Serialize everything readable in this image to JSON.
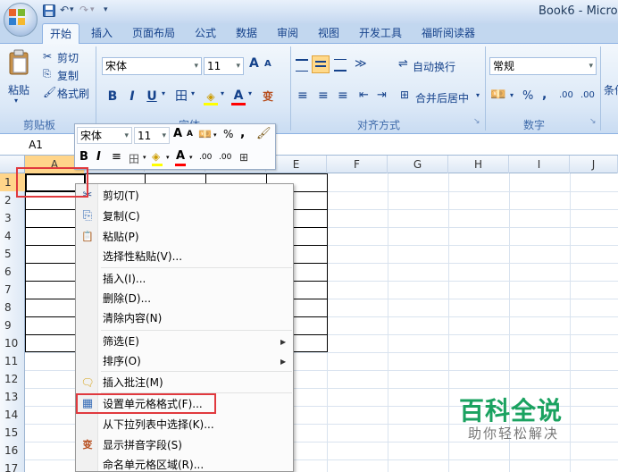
{
  "window": {
    "title": "Book6 - Micro",
    "qat_undo": "↶",
    "qat_redo": "↷",
    "qat_more": "▾"
  },
  "tabs": [
    "开始",
    "插入",
    "页面布局",
    "公式",
    "数据",
    "审阅",
    "视图",
    "开发工具",
    "福昕阅读器"
  ],
  "ribbon": {
    "clipboard": {
      "paste": "粘贴",
      "cut": "剪切",
      "copy": "复制",
      "format_painter": "格式刷",
      "group_label": "剪贴板"
    },
    "font": {
      "name": "宋体",
      "size": "11",
      "grow": "A",
      "shrink": "A",
      "bold": "B",
      "italic": "I",
      "underline": "U",
      "border": "田",
      "fill": "◈",
      "color": "A",
      "phonetic": "变",
      "group_label": "字体"
    },
    "alignment": {
      "wrap": "自动换行",
      "merge": "合并后居中",
      "group_label": "对齐方式"
    },
    "number": {
      "format": "常规",
      "percent": "%",
      "comma": ",",
      "inc_decimal": ".00",
      "dec_decimal": ".00",
      "group_label": "数字"
    },
    "styles_partial": "条件"
  },
  "formula_bar": {
    "name_box": "A1"
  },
  "columns": [
    "A",
    "B",
    "C",
    "D",
    "E",
    "F",
    "G",
    "H",
    "I",
    "J"
  ],
  "rows": [
    "1",
    "2",
    "3",
    "4",
    "5",
    "6",
    "7",
    "8",
    "9",
    "10",
    "11",
    "12",
    "13",
    "14",
    "15",
    "16",
    "17"
  ],
  "mini_toolbar": {
    "font": "宋体",
    "size": "11",
    "grow": "A",
    "shrink": "A",
    "percent": "%",
    "comma": ",",
    "bold": "B",
    "italic": "I",
    "align": "≡",
    "border": "田",
    "fill": "◈",
    "color": "A",
    "inc_decimal": ".00",
    "dec_decimal": ".00"
  },
  "context_menu": {
    "items": [
      {
        "label": "剪切(T)",
        "icon": "✂"
      },
      {
        "label": "复制(C)",
        "icon": "⎘"
      },
      {
        "label": "粘贴(P)",
        "icon": "📋"
      },
      {
        "label": "选择性粘贴(V)...",
        "icon": ""
      },
      {
        "label": "插入(I)...",
        "icon": ""
      },
      {
        "label": "删除(D)...",
        "icon": ""
      },
      {
        "label": "清除内容(N)",
        "icon": ""
      },
      {
        "label": "筛选(E)",
        "icon": ""
      },
      {
        "label": "排序(O)",
        "icon": ""
      },
      {
        "label": "插入批注(M)",
        "icon": "🗨"
      },
      {
        "label": "设置单元格格式(F)...",
        "icon": "▦"
      },
      {
        "label": "从下拉列表中选择(K)...",
        "icon": ""
      },
      {
        "label": "显示拼音字段(S)",
        "icon": "变"
      },
      {
        "label": "命名单元格区域(R)...",
        "icon": ""
      }
    ],
    "submenu_arrow": "▶"
  },
  "watermark": {
    "title": "百科全说",
    "subtitle": "助你轻松解决"
  },
  "colors": {
    "selection_highlight": "#e0393e",
    "ribbon_bg": "#dbe8f7",
    "watermark_green": "#1aa260"
  }
}
